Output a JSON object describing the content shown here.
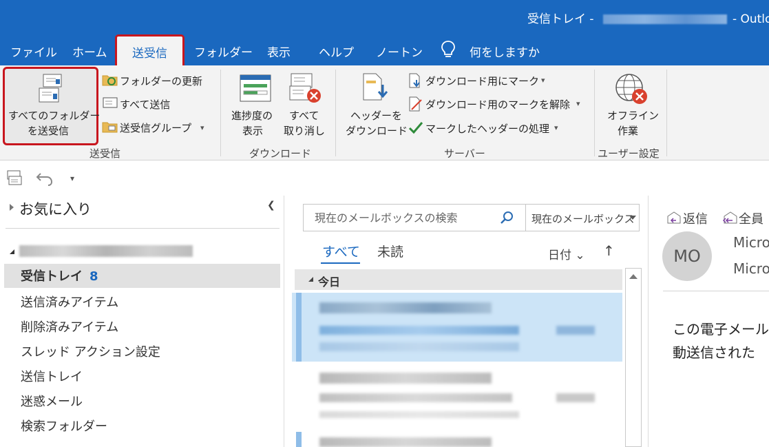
{
  "window": {
    "title_prefix": "受信トレイ - ",
    "title_suffix": "- Outlo"
  },
  "tabs": [
    {
      "label": "ファイル"
    },
    {
      "label": "ホーム"
    },
    {
      "label": "送受信"
    },
    {
      "label": "フォルダー"
    },
    {
      "label": "表示"
    },
    {
      "label": "ヘルプ"
    },
    {
      "label": "ノートン"
    }
  ],
  "tell_me": {
    "label": "何をしますか"
  },
  "ribbon": {
    "send_receive_group": {
      "label": "送受信",
      "send_receive_all_line1": "すべてのフォルダー",
      "send_receive_all_line2": "を送受信",
      "update_folder": "フォルダーの更新",
      "send_all": "すべて送信",
      "send_receive_groups": "送受信グループ"
    },
    "download_group": {
      "label": "ダウンロード",
      "show_progress_line1": "進捗度の",
      "show_progress_line2": "表示",
      "cancel_all_line1": "すべて",
      "cancel_all_line2": "取り消し"
    },
    "server_group": {
      "label": "サーバー",
      "download_headers_line1": "ヘッダーを",
      "download_headers_line2": "ダウンロード",
      "mark_to_download": "ダウンロード用にマーク",
      "unmark_to_download": "ダウンロード用のマークを解除",
      "process_marked_headers": "マークしたヘッダーの処理"
    },
    "preferences_group": {
      "label": "ユーザー設定",
      "work_offline_line1": "オフライン",
      "work_offline_line2": "作業"
    }
  },
  "folder_pane": {
    "favorites": "お気に入り",
    "folders": [
      {
        "label": "受信トレイ",
        "count": "8"
      },
      {
        "label": "送信済みアイテム"
      },
      {
        "label": "削除済みアイテム"
      },
      {
        "label": "スレッド アクション設定"
      },
      {
        "label": "送信トレイ"
      },
      {
        "label": "迷惑メール"
      },
      {
        "label": "検索フォルダー"
      }
    ]
  },
  "message_list": {
    "search_placeholder": "現在のメールボックスの検索",
    "search_scope": "現在のメールボックス",
    "filter_all": "すべて",
    "filter_unread": "未読",
    "sort_label": "日付",
    "group_today": "今日"
  },
  "reading_pane": {
    "reply": "返信",
    "reply_all": "全員",
    "avatar_initials": "MO",
    "sender_line1": "Micro",
    "sender_line2": "Micro",
    "body_line1": "この電子メール",
    "body_line2": "動送信された"
  },
  "colors": {
    "accent": "#1a68bf",
    "highlight": "#c8161e",
    "selected_mail": "#cce4f7"
  }
}
